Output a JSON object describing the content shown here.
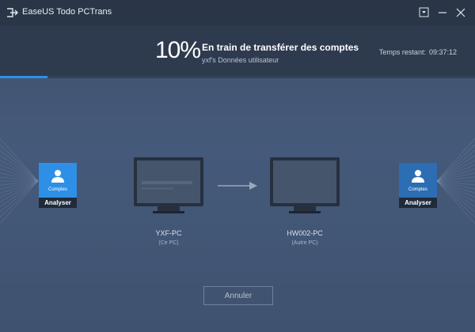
{
  "window": {
    "title": "EaseUS Todo PCTrans",
    "controls": [
      "download-icon",
      "minimize-icon",
      "close-icon"
    ]
  },
  "header": {
    "percent": "10%",
    "progress_fraction": 0.1,
    "status_title": "En train de transférer des comptes",
    "status_sub": "yxf's Données utilisateur",
    "remaining_label": "Temps restant:",
    "remaining_value": "09:37:12"
  },
  "source_account": {
    "label": "Comptes",
    "button": "Analyser",
    "icon": "user-icon",
    "color": "#2e8fe6"
  },
  "target_account": {
    "label": "Comptes",
    "button": "Analyser",
    "icon": "user-icon",
    "color": "#2c6db4"
  },
  "source_pc": {
    "name": "YXF-PC",
    "sub": "(Ce PC)"
  },
  "target_pc": {
    "name": "HW002-PC",
    "sub": "(Autre PC)"
  },
  "arrow_icon": "arrow-right-icon",
  "footer": {
    "cancel_label": "Annuler"
  },
  "colors": {
    "accent": "#2e8fe6",
    "titlebar": "#2a3647",
    "header": "#2e3b4f",
    "background": "#45597a"
  }
}
